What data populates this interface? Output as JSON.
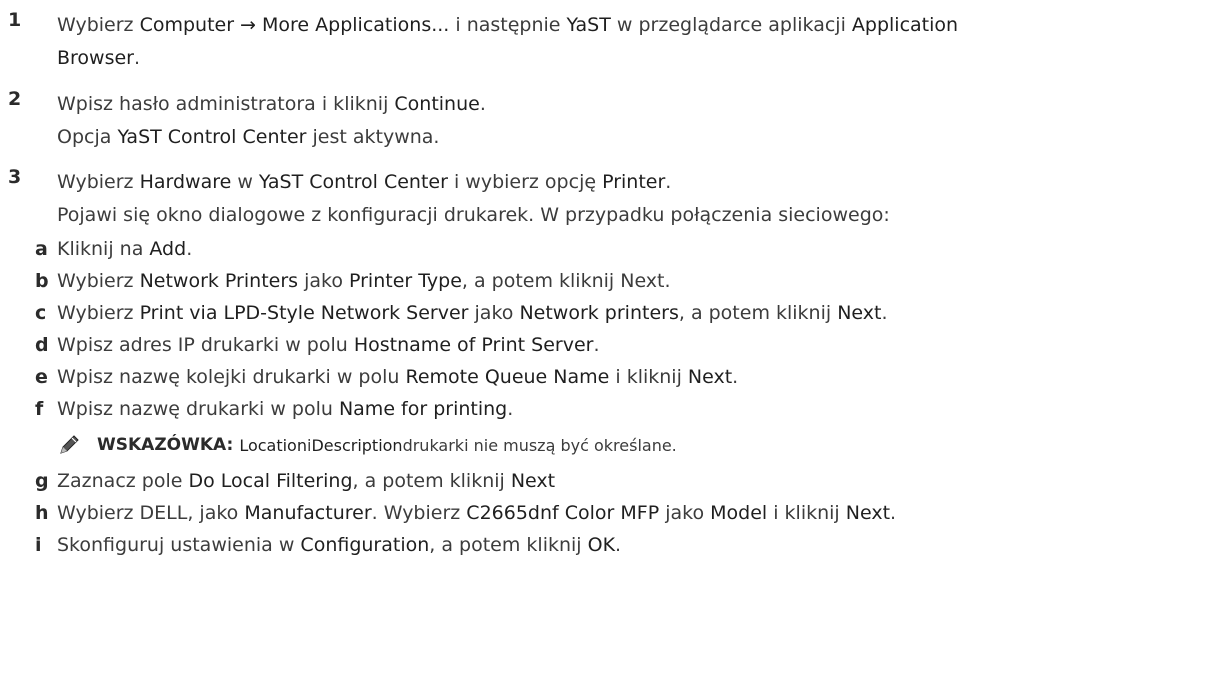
{
  "steps": [
    {
      "number": "1",
      "line1": {
        "t1": "Wybierz ",
        "b1": "Computer → More Applications...",
        "t2": " i następnie ",
        "b2": "YaST",
        "t3": " w przeglądarce aplikacji ",
        "b3": "Application"
      },
      "line2": {
        "b1": "Browser",
        "t1": "."
      }
    },
    {
      "number": "2",
      "line1": {
        "t1": "Wpisz hasło administratora i kliknij ",
        "b1": "Continue",
        "t2": "."
      },
      "line2": {
        "t1": "Opcja ",
        "b1": "YaST Control Center",
        "t2": " jest aktywna."
      }
    },
    {
      "number": "3",
      "line1": {
        "t1": "Wybierz ",
        "b1": "Hardware",
        "t2": " w ",
        "b2": "YaST Control Center",
        "t3": " i wybierz opcję ",
        "b3": "Printer",
        "t4": "."
      },
      "line2": {
        "t1": "Pojawi się okno dialogowe z konfiguracji drukarek. W przypadku połączenia sieciowego:"
      }
    }
  ],
  "substeps": {
    "a": {
      "letter": "a",
      "t1": "Kliknij na ",
      "b1": "Add",
      "t2": "."
    },
    "b": {
      "letter": "b",
      "t1": "Wybierz ",
      "b1": "Network Printers",
      "t2": " jako ",
      "b2": "Printer Type",
      "t3": ", a potem kliknij Next."
    },
    "c": {
      "letter": "c",
      "t1": "Wybierz ",
      "b1": "Print via LPD-Style Network Server",
      "t2": " jako ",
      "b2": "Network printers",
      "t3": ", a potem kliknij ",
      "b3": "Next",
      "t4": "."
    },
    "d": {
      "letter": "d",
      "t1": "Wpisz adres IP drukarki w polu ",
      "b1": "Hostname of Print Server",
      "t2": "."
    },
    "e": {
      "letter": "e",
      "t1": "Wpisz nazwę kolejki drukarki w polu ",
      "b1": "Remote Queue Name",
      "t2": " i kliknij ",
      "b2": "Next",
      "t3": "."
    },
    "f": {
      "letter": "f",
      "t1": "Wpisz nazwę drukarki w polu ",
      "b1": "Name for printing",
      "t2": "."
    },
    "g": {
      "letter": "g",
      "t1": "Zaznacz pole ",
      "b1": "Do Local Filtering",
      "t2": ", a potem kliknij ",
      "b2": "Next"
    },
    "h": {
      "letter": "h",
      "t1": "Wybierz DELL, jako ",
      "b1": "Manufacturer",
      "t2": ". Wybierz ",
      "b2": "C2665dnf Color MFP",
      "t3": " jako ",
      "b3": "Model",
      "t4": " i kliknij ",
      "b4": "Next",
      "t5": "."
    },
    "i": {
      "letter": "i",
      "t1": "Skonfiguruj ustawienia w ",
      "b1": "Configuration",
      "t2": ", a potem kliknij ",
      "b2": "OK",
      "t3": "."
    }
  },
  "note": {
    "icon": "pencil-note-icon",
    "label": "WSKAZÓWKA:",
    "t1": " ",
    "b1": "Location",
    "t2": " i ",
    "b2": "Description",
    "t3": " drukarki nie muszą być określane."
  }
}
